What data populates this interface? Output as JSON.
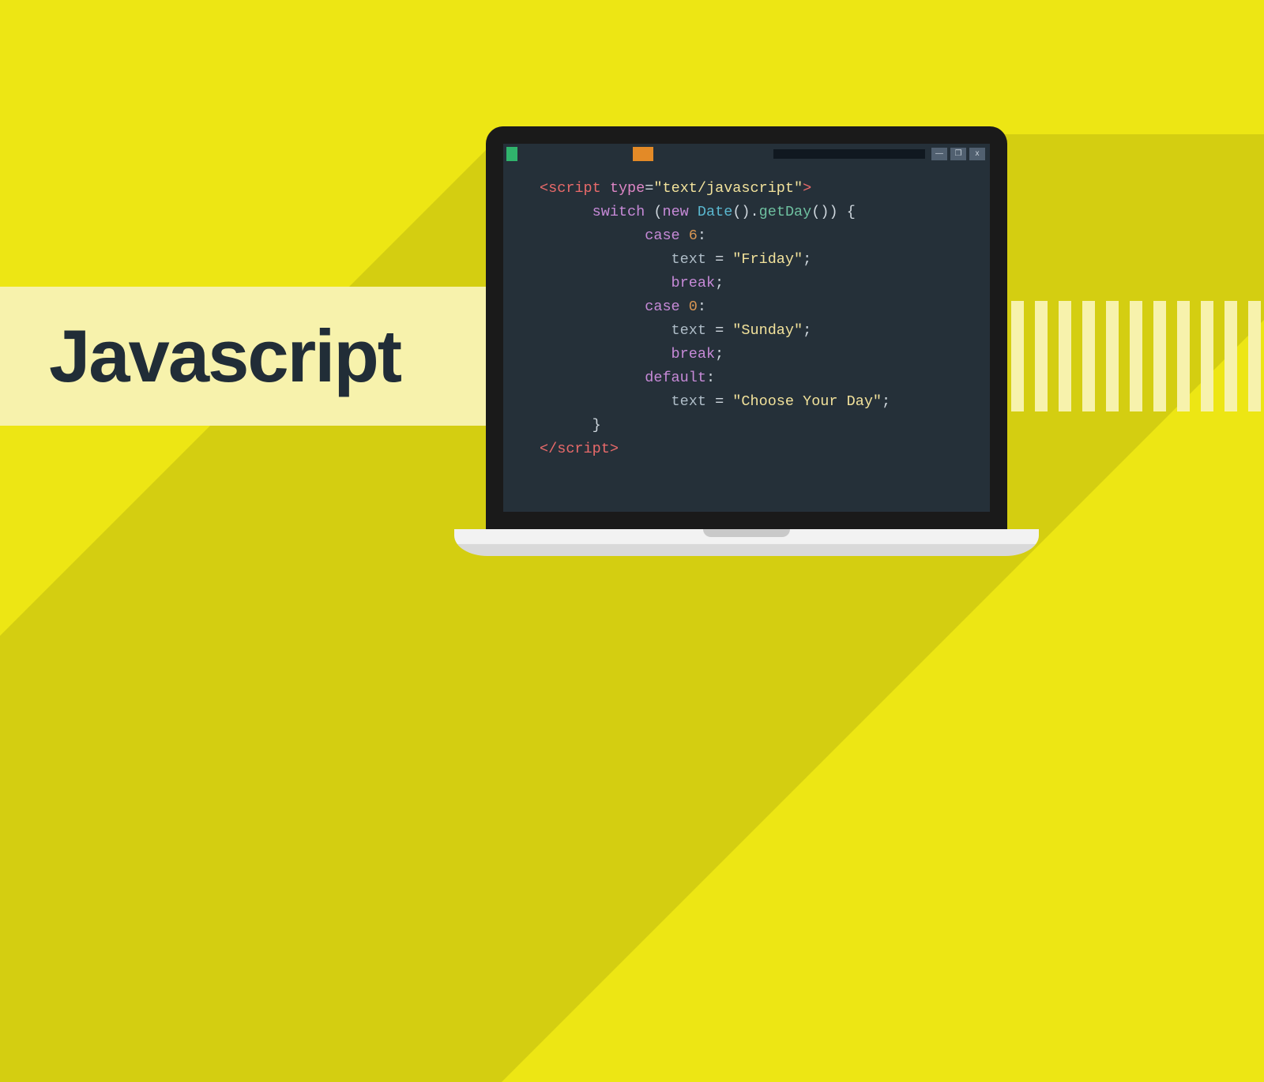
{
  "title": "Javascript",
  "window_controls": {
    "min": "—",
    "max": "❐",
    "close": "x"
  },
  "code": {
    "open_tag": {
      "lt": "<",
      "name": "script",
      "sp": " ",
      "attr": "type",
      "eq": "=",
      "q1": "\"",
      "val": "text/javascript",
      "q2": "\"",
      "gt": ">"
    },
    "switch": {
      "kw": "switch",
      "sp1": " ",
      "lp": "(",
      "new_kw": "new",
      "sp2": " ",
      "cls": "Date",
      "lp2": "(",
      "rp2": ")",
      "dot": ".",
      "method": "getDay",
      "lp3": "(",
      "rp3": ")",
      "rp": ")",
      "sp3": " ",
      "lb": "{"
    },
    "case1": {
      "kw": "case",
      "sp": " ",
      "num": "6",
      "colon": ":"
    },
    "case1_body": {
      "var": "text",
      "sp1": " ",
      "eq": "=",
      "sp2": " ",
      "q1": "\"",
      "str": "Friday",
      "q2": "\"",
      "semi": ";"
    },
    "break1": {
      "kw": "break",
      "semi": ";"
    },
    "case2": {
      "kw": "case",
      "sp": " ",
      "num": "0",
      "colon": ":"
    },
    "case2_body": {
      "var": "text",
      "sp1": " ",
      "eq": "=",
      "sp2": " ",
      "q1": "\"",
      "str": "Sunday",
      "q2": "\"",
      "semi": ";"
    },
    "break2": {
      "kw": "break",
      "semi": ";"
    },
    "default": {
      "kw": "default",
      "colon": ":"
    },
    "default_body": {
      "var": "text",
      "sp1": " ",
      "eq": "=",
      "sp2": " ",
      "q1": "\"",
      "str": "Choose Your Day",
      "q2": "\"",
      "semi": ";"
    },
    "close_brace": "}",
    "close_tag": {
      "lt": "<",
      "slash": "/",
      "name": "script",
      "gt": ">"
    }
  }
}
